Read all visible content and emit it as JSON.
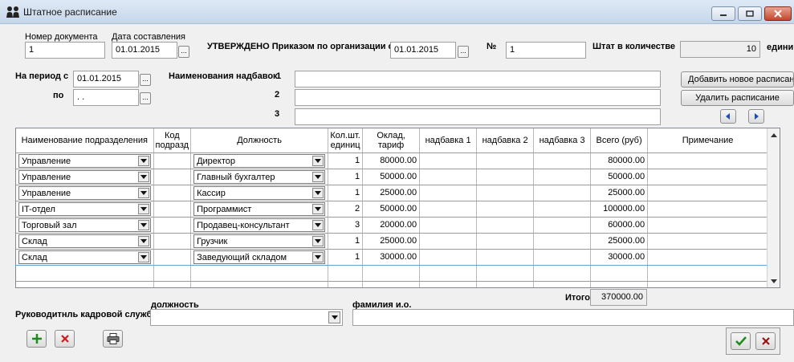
{
  "window": {
    "title": "Штатное расписание"
  },
  "header": {
    "doc_number_label": "Номер документа",
    "doc_number": "1",
    "date_label": "Дата составления",
    "date": "01.01.2015",
    "approved_label": "УТВЕРЖДЕНО Приказом по организации от",
    "approved_date": "01.01.2015",
    "number_sign": "№",
    "order_number": "1",
    "staff_label": "Штат в количестве",
    "staff_count": "10",
    "staff_unit": "едини",
    "period_from_label": "На период с",
    "period_from": "01.01.2015",
    "period_to_label": "по",
    "period_to": " .  .",
    "allowances_label": "Наименования надбавок:",
    "allowance_nums": [
      "1",
      "2",
      "3"
    ],
    "allowances": [
      "",
      "",
      ""
    ],
    "dots": "..."
  },
  "buttons": {
    "add_schedule": "Добавить новое расписание",
    "delete_schedule": "Удалить расписание"
  },
  "table": {
    "columns": [
      "Наименование подразделения",
      "Код подразд",
      "Должность",
      "Кол.шт. единиц",
      "Оклад, тариф",
      "надбавка 1",
      "надбавка 2",
      "надбавка 3",
      "Всего (руб)",
      "Примечание"
    ],
    "rows": [
      {
        "dept": "Управление",
        "code": "",
        "position": "Директор",
        "units": "1",
        "salary": "80000.00",
        "a1": "",
        "a2": "",
        "a3": "",
        "total": "80000.00",
        "note": ""
      },
      {
        "dept": "Управление",
        "code": "",
        "position": "Главный бухгалтер",
        "units": "1",
        "salary": "50000.00",
        "a1": "",
        "a2": "",
        "a3": "",
        "total": "50000.00",
        "note": ""
      },
      {
        "dept": "Управление",
        "code": "",
        "position": "Кассир",
        "units": "1",
        "salary": "25000.00",
        "a1": "",
        "a2": "",
        "a3": "",
        "total": "25000.00",
        "note": ""
      },
      {
        "dept": "IT-отдел",
        "code": "",
        "position": "Программист",
        "units": "2",
        "salary": "50000.00",
        "a1": "",
        "a2": "",
        "a3": "",
        "total": "100000.00",
        "note": ""
      },
      {
        "dept": "Торговый зал",
        "code": "",
        "position": "Продавец-консультант",
        "units": "3",
        "salary": "20000.00",
        "a1": "",
        "a2": "",
        "a3": "",
        "total": "60000.00",
        "note": ""
      },
      {
        "dept": "Склад",
        "code": "",
        "position": "Грузчик",
        "units": "1",
        "salary": "25000.00",
        "a1": "",
        "a2": "",
        "a3": "",
        "total": "25000.00",
        "note": ""
      },
      {
        "dept": "Склад",
        "code": "",
        "position": "Заведующий складом",
        "units": "1",
        "salary": "30000.00",
        "a1": "",
        "a2": "",
        "a3": "",
        "total": "30000.00",
        "note": ""
      }
    ]
  },
  "footer": {
    "total_label": "Итого",
    "total_value": "370000.00",
    "hr_head_label": "Руководитнль кадровой службы",
    "position_label": "должность",
    "position_value": "",
    "fullname_label": "фамилия и.о.",
    "fullname_value": ""
  },
  "icons": {
    "app": "people-icon",
    "add": "plus-icon",
    "delete": "cross-icon",
    "print": "printer-icon",
    "ok": "check-icon",
    "cancel": "cancel-icon"
  }
}
